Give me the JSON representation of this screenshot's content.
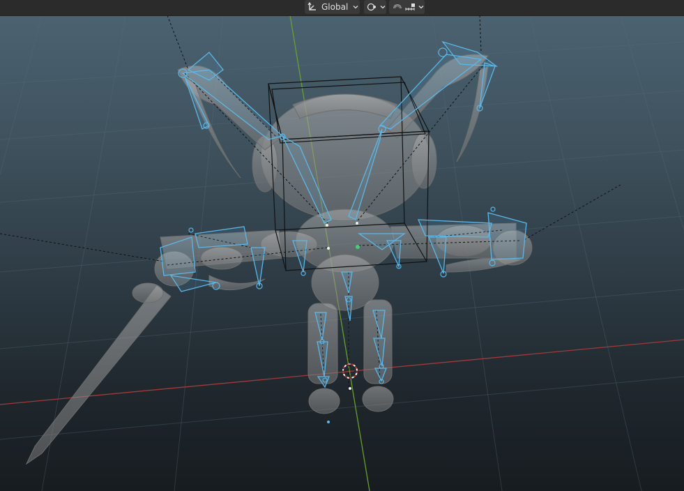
{
  "header": {
    "transform_orientation": {
      "icon": "transform-orientation-icon",
      "label": "Global"
    },
    "pivot_point": {
      "icon": "pivot-point-icon"
    },
    "snap": {
      "icon": "snap-magnet-icon"
    },
    "snap_target": {
      "icon": "snap-increment-icon"
    }
  },
  "viewport": {
    "axis_colors": {
      "x": "#a33a3a",
      "y": "#6aa02a"
    },
    "bone_color": "#5bb8e8",
    "mesh_color": "#9a9a9a",
    "cursor_color": "#d03030"
  }
}
